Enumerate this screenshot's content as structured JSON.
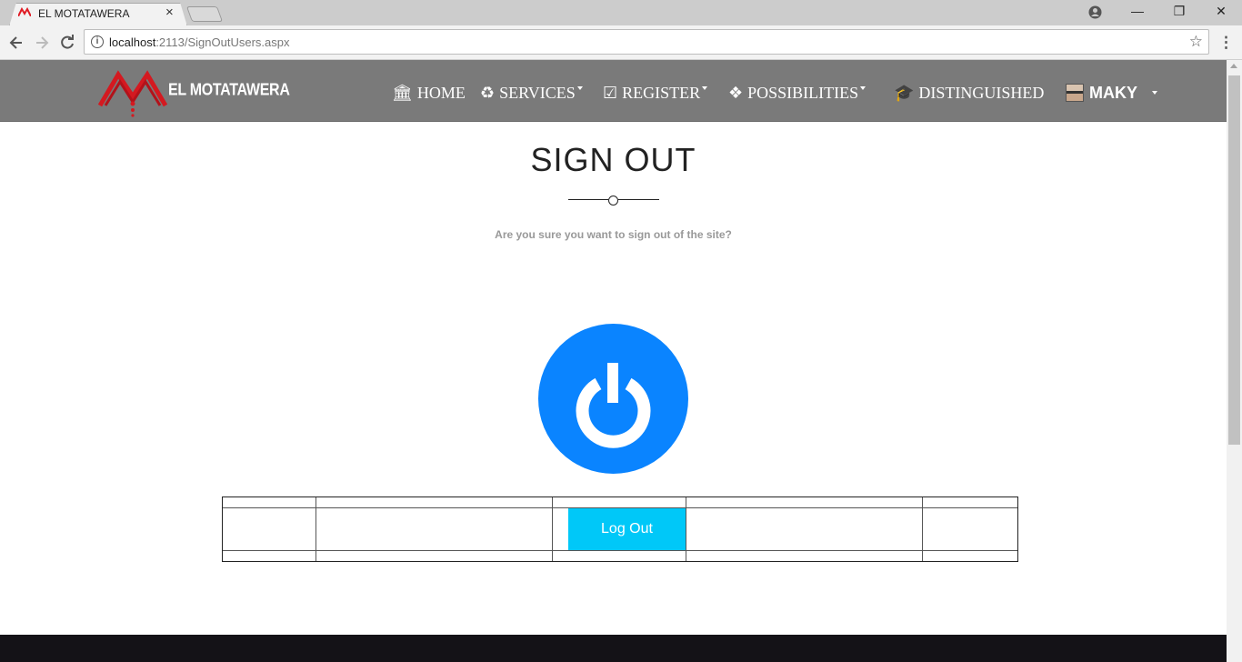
{
  "browser": {
    "tab_title": "EL MOTATAWERA",
    "tab_close": "×",
    "url_host": "localhost",
    "url_path": ":2113/SignOutUsers.aspx",
    "info_glyph": "i",
    "window_minimize": "—",
    "window_restore": "❐",
    "window_close": "✕"
  },
  "navbar": {
    "brand": "EL MOTATAWERA",
    "items": [
      {
        "label": "HOME",
        "icon": "bank-icon",
        "glyph": "🏛",
        "dropdown": false
      },
      {
        "label": "SERVICES",
        "icon": "recycle-icon",
        "glyph": "♻",
        "dropdown": true
      },
      {
        "label": "REGISTER",
        "icon": "checkbox-icon",
        "glyph": "☑",
        "dropdown": true
      },
      {
        "label": "POSSIBILITIES",
        "icon": "cubes-icon",
        "glyph": "❖",
        "dropdown": true
      },
      {
        "label": "DISTINGUISHED",
        "icon": "graduation-cap-icon",
        "glyph": "🎓",
        "dropdown": false
      }
    ],
    "user": {
      "name": "MAKY"
    }
  },
  "main": {
    "title": "SIGN OUT",
    "subtitle": "Are you sure you want to sign out of the site?",
    "logout_label": "Log Out"
  },
  "colors": {
    "navbar_bg": "#7a7a7a",
    "power_button": "#0a84ff",
    "logout_button": "#00c8f8",
    "footer_bg": "#141217",
    "logo_red": "#e01b24"
  }
}
